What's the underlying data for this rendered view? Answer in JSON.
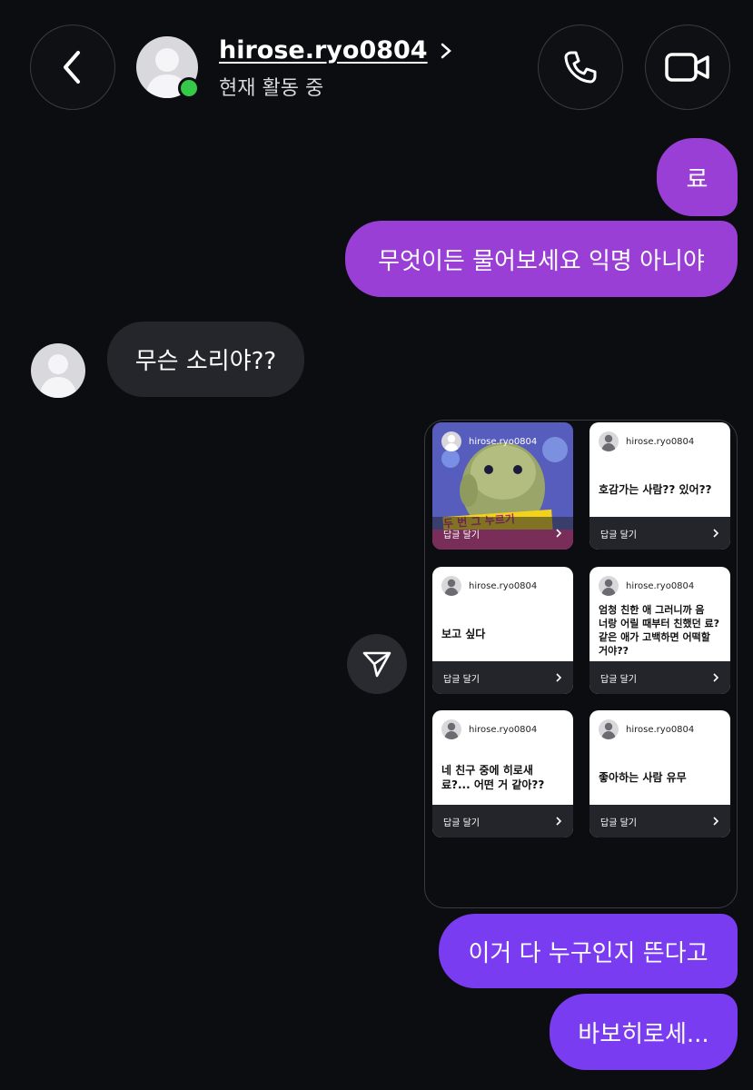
{
  "header": {
    "username": "hirose.ryo0804",
    "status": "현재 활동 중",
    "icons": {
      "back": "chevron-left-icon",
      "call": "phone-icon",
      "video": "video-camera-icon"
    }
  },
  "messages": {
    "m1": "료",
    "m2": "무엇이든 물어보세요 익명 아니야",
    "m3": "무슨 소리야??",
    "m4": "이거 다 누구인지 뜬다고",
    "m5": "바보히로세..."
  },
  "shared_post": {
    "cards": [
      {
        "user": "hirose.ryo0804",
        "question": "",
        "reply": "답글 달기"
      },
      {
        "user": "hirose.ryo0804",
        "question": "호감가는 사람?? 있어??",
        "reply": "답글 달기"
      },
      {
        "user": "hirose.ryo0804",
        "question": "보고 싶다",
        "reply": "답글 달기"
      },
      {
        "user": "hirose.ryo0804",
        "question": "엄청 친한 애 그러니까 음\n너랑 어릴 때부터 친했던 료?\n같은 애가 고백하면 어떡할\n거야??",
        "reply": "답글 달기"
      },
      {
        "user": "hirose.ryo0804",
        "question": "네 친구 중에 히로새\n료?... 어떤 거 같아??",
        "reply": "답글 달기"
      },
      {
        "user": "hirose.ryo0804",
        "question": "좋아하는 사람 유무",
        "reply": "답글 달기"
      }
    ],
    "photo_banner_text": "두 번 그 누르기"
  },
  "colors": {
    "bubble_purple": "#9a3fd6",
    "bubble_violet": "#7a3cf0",
    "bubble_received": "#25262b",
    "online": "#35c94a"
  }
}
